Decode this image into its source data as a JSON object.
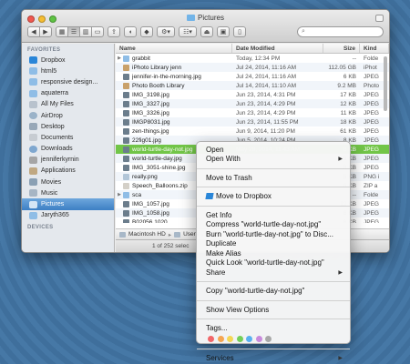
{
  "window": {
    "title": "Pictures",
    "search_placeholder": ""
  },
  "toolbar": {
    "back_icon": "chevron-left-icon",
    "forward_icon": "chevron-right-icon",
    "views": [
      "icon-view-icon",
      "list-view-icon",
      "column-view-icon",
      "cover-flow-icon"
    ],
    "share_icon": "share-icon",
    "tags_icon": "tag-icon",
    "dropbox_icon": "dropbox-icon",
    "action_icon": "gear-icon",
    "arrange_icon": "arrange-icon",
    "eject_icon": "eject-icon",
    "newfolder_icon": "new-folder-icon",
    "trash_icon": "trash-icon"
  },
  "sidebar": {
    "favorites_heading": "FAVORITES",
    "items": [
      {
        "label": "Dropbox",
        "icon": "dropbox"
      },
      {
        "label": "html5",
        "icon": "folder"
      },
      {
        "label": "responsive design...",
        "icon": "folder"
      },
      {
        "label": "aquaterra",
        "icon": "folder"
      },
      {
        "label": "All My Files",
        "icon": "files"
      },
      {
        "label": "AirDrop",
        "icon": "airdrop"
      },
      {
        "label": "Desktop",
        "icon": "desktop"
      },
      {
        "label": "Documents",
        "icon": "docs"
      },
      {
        "label": "Downloads",
        "icon": "downloads"
      },
      {
        "label": "jenniferkyrnin",
        "icon": "home"
      },
      {
        "label": "Applications",
        "icon": "apps"
      },
      {
        "label": "Movies",
        "icon": "movies"
      },
      {
        "label": "Music",
        "icon": "music"
      },
      {
        "label": "Pictures",
        "icon": "pictures"
      },
      {
        "label": "Jaryth365",
        "icon": "folder"
      }
    ],
    "devices_heading": "DEVICES"
  },
  "columns": {
    "name": "Name",
    "date": "Date Modified",
    "size": "Size",
    "kind": "Kind"
  },
  "files": [
    {
      "name": "grabbit",
      "date": "Today, 12:34 PM",
      "size": "--",
      "kind": "Folde",
      "type": "folder",
      "disclosure": true
    },
    {
      "name": "iPhoto Library jenn",
      "date": "Jul 24, 2014, 11:16 AM",
      "size": "112.05 GB",
      "kind": "iPhot",
      "type": "lib",
      "disclosure": false
    },
    {
      "name": "jennifer-in-the-morning.jpg",
      "date": "Jul 24, 2014, 11:16 AM",
      "size": "6 KB",
      "kind": "JPEG",
      "type": "img",
      "disclosure": false
    },
    {
      "name": "Photo Booth Library",
      "date": "Jul 14, 2014, 11:10 AM",
      "size": "9.2 MB",
      "kind": "Photo",
      "type": "lib",
      "disclosure": false
    },
    {
      "name": "IMG_3198.jpg",
      "date": "Jun 23, 2014, 4:31 PM",
      "size": "17 KB",
      "kind": "JPEG",
      "type": "img",
      "disclosure": false
    },
    {
      "name": "IMG_3327.jpg",
      "date": "Jun 23, 2014, 4:29 PM",
      "size": "12 KB",
      "kind": "JPEG",
      "type": "img",
      "disclosure": false
    },
    {
      "name": "IMG_3326.jpg",
      "date": "Jun 23, 2014, 4:29 PM",
      "size": "11 KB",
      "kind": "JPEG",
      "type": "img",
      "disclosure": false
    },
    {
      "name": "IMGP8031.jpg",
      "date": "Jun 23, 2014, 11:55 PM",
      "size": "18 KB",
      "kind": "JPEG",
      "type": "img",
      "disclosure": false
    },
    {
      "name": "zen-things.jpg",
      "date": "Jun 9, 2014, 11:20 PM",
      "size": "61 KB",
      "kind": "JPEG",
      "type": "img",
      "disclosure": false
    },
    {
      "name": "22fig01.jpg",
      "date": "Jun 5, 2014, 10:24 PM",
      "size": "8 KB",
      "kind": "JPEG",
      "type": "img",
      "disclosure": false
    },
    {
      "name": "world-turtle-day-not.jpg",
      "date": "May 28, 2014, 11:43 AM",
      "size": "8 KB",
      "kind": "JPEG",
      "type": "img",
      "disclosure": false,
      "selected": true
    },
    {
      "name": "world-turtle-day.jpg",
      "date": "",
      "size": "8 KB",
      "kind": "JPEG",
      "type": "img",
      "disclosure": false
    },
    {
      "name": "IMG_3051-shine.jpg",
      "date": "",
      "size": "8 KB",
      "kind": "JPEG",
      "type": "img",
      "disclosure": false
    },
    {
      "name": "really.png",
      "date": "",
      "size": "5 KB",
      "kind": "PNG i",
      "type": "png",
      "disclosure": false
    },
    {
      "name": "Speech_Balloons.zip",
      "date": "",
      "size": "8 KB",
      "kind": "ZIP a",
      "type": "zip",
      "disclosure": false
    },
    {
      "name": "sca",
      "date": "",
      "size": "--",
      "kind": "Folde",
      "type": "folder",
      "disclosure": true
    },
    {
      "name": "IMG_1057.jpg",
      "date": "",
      "size": "12 KB",
      "kind": "JPEG",
      "type": "img",
      "disclosure": false
    },
    {
      "name": "IMG_1058.jpg",
      "date": "",
      "size": "8 KB",
      "kind": "JPEG",
      "type": "img",
      "disclosure": false
    },
    {
      "name": "B02056 1020....",
      "date": "",
      "size": "8 KB",
      "kind": "JPEG",
      "type": "img",
      "disclosure": false
    }
  ],
  "pathbar": {
    "items": [
      "Macintosh HD",
      "Users"
    ]
  },
  "status": {
    "text": "1 of 252 selec"
  },
  "context_menu": {
    "open": "Open",
    "open_with": "Open With",
    "move_to_trash": "Move to Trash",
    "move_to_dropbox": "Move to Dropbox",
    "get_info": "Get Info",
    "compress": "Compress \"world-turtle-day-not.jpg\"",
    "burn": "Burn \"world-turtle-day-not.jpg\" to Disc...",
    "duplicate": "Duplicate",
    "make_alias": "Make Alias",
    "quick_look": "Quick Look \"world-turtle-day-not.jpg\"",
    "share": "Share",
    "copy": "Copy \"world-turtle-day-not.jpg\"",
    "show_view_options": "Show View Options",
    "tags": "Tags...",
    "tag_colors": [
      "#f1676a",
      "#f5a652",
      "#f4d755",
      "#74cf5a",
      "#5ab0f0",
      "#c98bdc",
      "#a8a8a8"
    ],
    "services": "Services",
    "submenu_arrow": "▶"
  }
}
